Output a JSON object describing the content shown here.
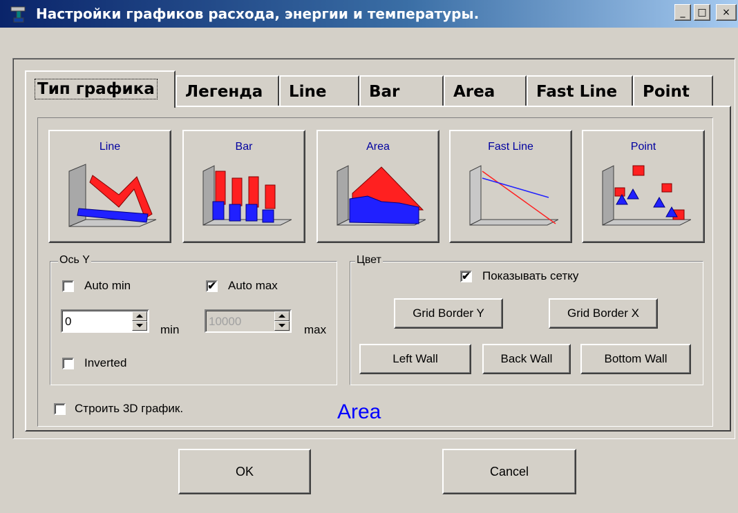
{
  "window": {
    "title": "Настройки графиков расхода, энергии и температуры.",
    "controls": {
      "minimize": "_",
      "maximize": "□",
      "close": "×"
    }
  },
  "tabs": [
    {
      "label": "Тип графика",
      "active": true
    },
    {
      "label": "Легенда"
    },
    {
      "label": "Line"
    },
    {
      "label": "Bar"
    },
    {
      "label": "Area"
    },
    {
      "label": "Fast Line"
    },
    {
      "label": "Point"
    }
  ],
  "chart_types": [
    {
      "label": "Line",
      "icon": "line-chart-icon"
    },
    {
      "label": "Bar",
      "icon": "bar-chart-icon"
    },
    {
      "label": "Area",
      "icon": "area-chart-icon"
    },
    {
      "label": "Fast Line",
      "icon": "fast-line-chart-icon"
    },
    {
      "label": "Point",
      "icon": "point-chart-icon"
    }
  ],
  "axis_y": {
    "title": "Ось Y",
    "auto_min": {
      "label": "Auto min",
      "checked": false
    },
    "auto_max": {
      "label": "Auto max",
      "checked": true
    },
    "min": {
      "value": "0",
      "label": "min"
    },
    "max": {
      "value": "10000",
      "label": "max",
      "disabled": true
    },
    "inverted": {
      "label": "Inverted",
      "checked": false
    }
  },
  "color": {
    "title": "Цвет",
    "show_grid": {
      "label": "Показывать сетку",
      "checked": true
    },
    "buttons": {
      "grid_border_y": "Grid Border Y",
      "grid_border_x": "Grid Border X",
      "left_wall": "Left Wall",
      "back_wall": "Back Wall",
      "bottom_wall": "Bottom Wall"
    }
  },
  "build_3d": {
    "label": "Строить 3D график.",
    "checked": false
  },
  "selected_type_label": "Area",
  "footer": {
    "ok": "OK",
    "cancel": "Cancel"
  },
  "colors": {
    "title_start": "#0a246a",
    "title_end": "#a6caf0",
    "face": "#d4d0c8",
    "accent_label": "#0000ff"
  }
}
